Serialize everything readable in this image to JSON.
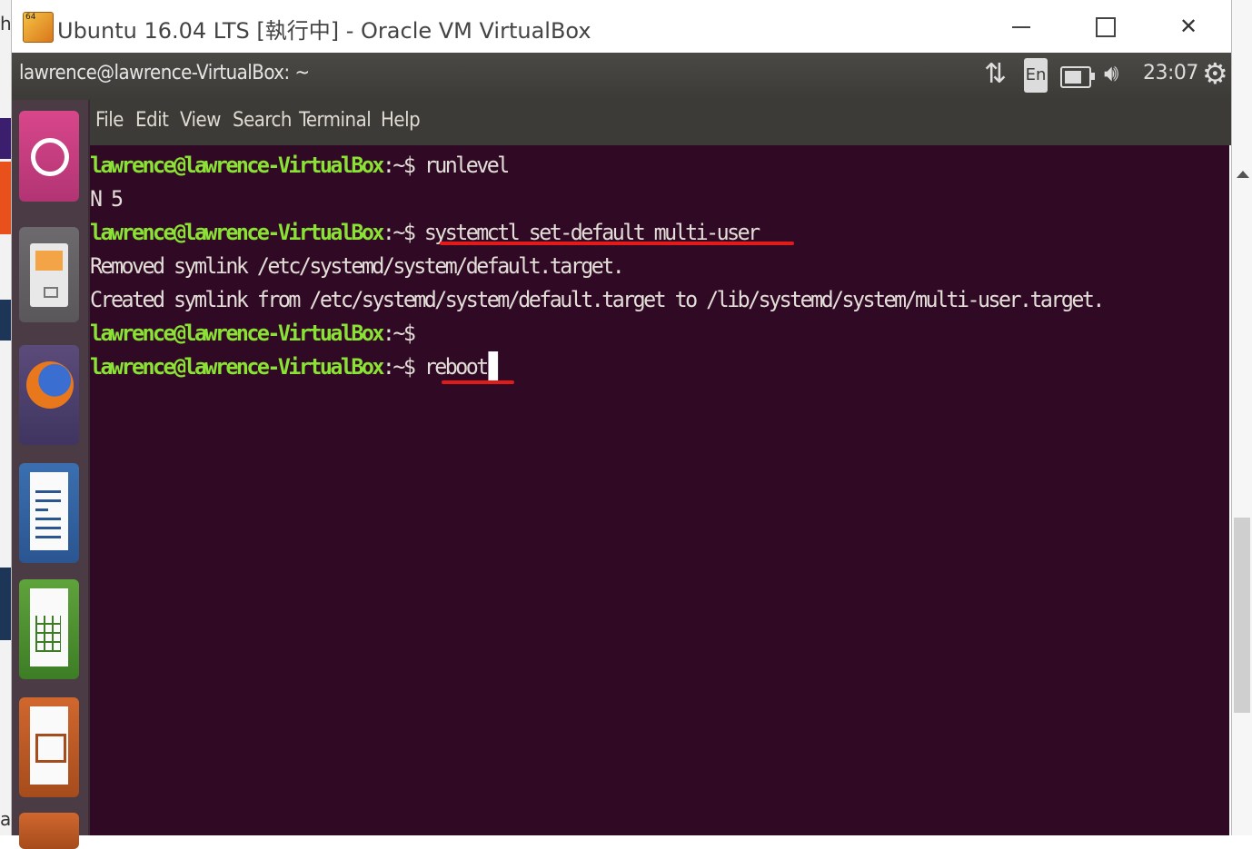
{
  "vbox": {
    "title": "Ubuntu 16.04 LTS [執行中] - Oracle VM VirtualBox",
    "icon_badge": "64"
  },
  "panel": {
    "title": "lawrence@lawrence-VirtualBox: ~",
    "lang": "En",
    "time": "23:07"
  },
  "menu": [
    "File",
    "Edit",
    "View",
    "Search",
    "Terminal",
    "Help"
  ],
  "terminal": {
    "prompt": "lawrence@lawrence-VirtualBox",
    "path": ":~$",
    "lines": [
      {
        "type": "prompt",
        "cmd": " runlevel"
      },
      {
        "type": "output",
        "text": "N 5"
      },
      {
        "type": "prompt",
        "cmd": " systemctl set-default multi-user"
      },
      {
        "type": "output",
        "text": "Removed symlink /etc/systemd/system/default.target."
      },
      {
        "type": "output",
        "text": "Created symlink from /etc/systemd/system/default.target to /lib/systemd/system/multi-user.target."
      },
      {
        "type": "prompt",
        "cmd": ""
      },
      {
        "type": "prompt",
        "cmd": " reboot"
      }
    ]
  },
  "host_left_glyphs": [
    "h",
    "a"
  ],
  "colors": {
    "terminal_bg": "#300a24",
    "prompt": "#8ae234",
    "underline_annotation": "#e11a1a"
  }
}
